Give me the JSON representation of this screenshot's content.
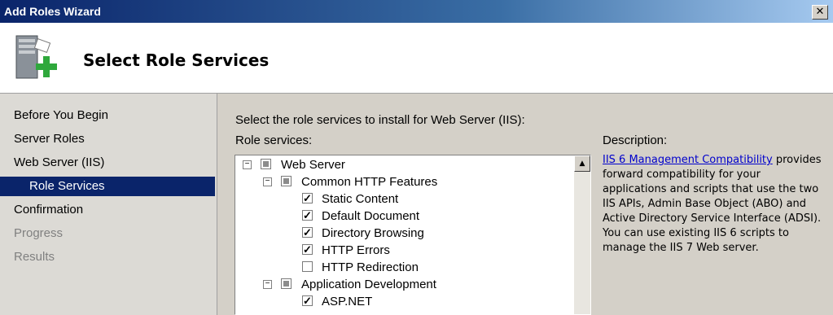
{
  "window": {
    "title": "Add Roles Wizard",
    "close_glyph": "✕"
  },
  "header": {
    "title": "Select Role Services",
    "icon": "server-add-icon"
  },
  "nav": {
    "items": [
      {
        "label": "Before You Begin",
        "state": "normal"
      },
      {
        "label": "Server Roles",
        "state": "normal"
      },
      {
        "label": "Web Server (IIS)",
        "state": "normal"
      },
      {
        "label": "Role Services",
        "state": "active"
      },
      {
        "label": "Confirmation",
        "state": "normal"
      },
      {
        "label": "Progress",
        "state": "disabled"
      },
      {
        "label": "Results",
        "state": "disabled"
      }
    ]
  },
  "main": {
    "instruction": "Select the role services to install for Web Server (IIS):",
    "role_services_label": "Role services:",
    "description_label": "Description:",
    "description_link": "IIS 6 Management Compatibility",
    "description_text": "provides forward compatibility for your applications and scripts that use the two IIS APIs, Admin Base Object (ABO) and Active Directory Service Interface (ADSI). You can use existing IIS 6 scripts to manage the IIS 7 Web server."
  },
  "tree": [
    {
      "label": "Web Server",
      "level": 0,
      "expander": "−",
      "check": "partial"
    },
    {
      "label": "Common HTTP Features",
      "level": 1,
      "expander": "−",
      "check": "partial"
    },
    {
      "label": "Static Content",
      "level": 2,
      "check": "checked"
    },
    {
      "label": "Default Document",
      "level": 2,
      "check": "checked"
    },
    {
      "label": "Directory Browsing",
      "level": 2,
      "check": "checked"
    },
    {
      "label": "HTTP Errors",
      "level": 2,
      "check": "checked"
    },
    {
      "label": "HTTP Redirection",
      "level": 2,
      "check": "unchecked"
    },
    {
      "label": "Application Development",
      "level": 1,
      "expander": "−",
      "check": "partial"
    },
    {
      "label": "ASP.NET",
      "level": 2,
      "check": "checked"
    }
  ],
  "scrollbar": {
    "up_glyph": "▲"
  }
}
